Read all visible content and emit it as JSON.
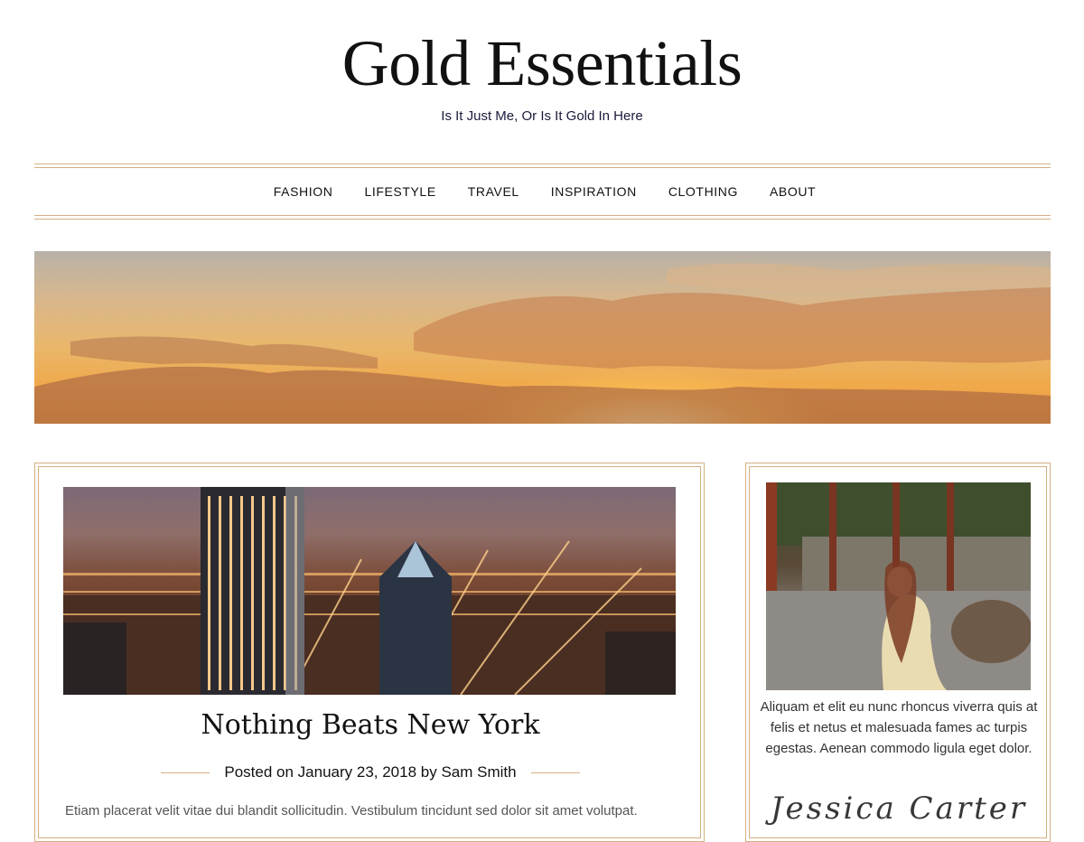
{
  "site": {
    "title": "Gold Essentials",
    "tagline": "Is It Just Me, Or Is It Gold In Here"
  },
  "nav": {
    "items": [
      {
        "label": "FASHION"
      },
      {
        "label": "LIFESTYLE"
      },
      {
        "label": "TRAVEL"
      },
      {
        "label": "INSPIRATION"
      },
      {
        "label": "CLOTHING"
      },
      {
        "label": "ABOUT"
      }
    ]
  },
  "post": {
    "title": "Nothing Beats New York",
    "meta": "Posted on January 23, 2018 by Sam Smith",
    "excerpt": "Etiam placerat velit vitae dui blandit sollicitudin. Vestibulum tincidunt sed dolor sit amet volutpat."
  },
  "sidebar": {
    "about_text": "Aliquam et elit eu nunc rhoncus viverra quis at felis et netus et malesuada fames ac turpis egestas. Aenean commodo ligula eget dolor.",
    "signature": "Jessica Carter"
  },
  "colors": {
    "accent_gold": "#d4b083",
    "text_dark": "#111111"
  }
}
